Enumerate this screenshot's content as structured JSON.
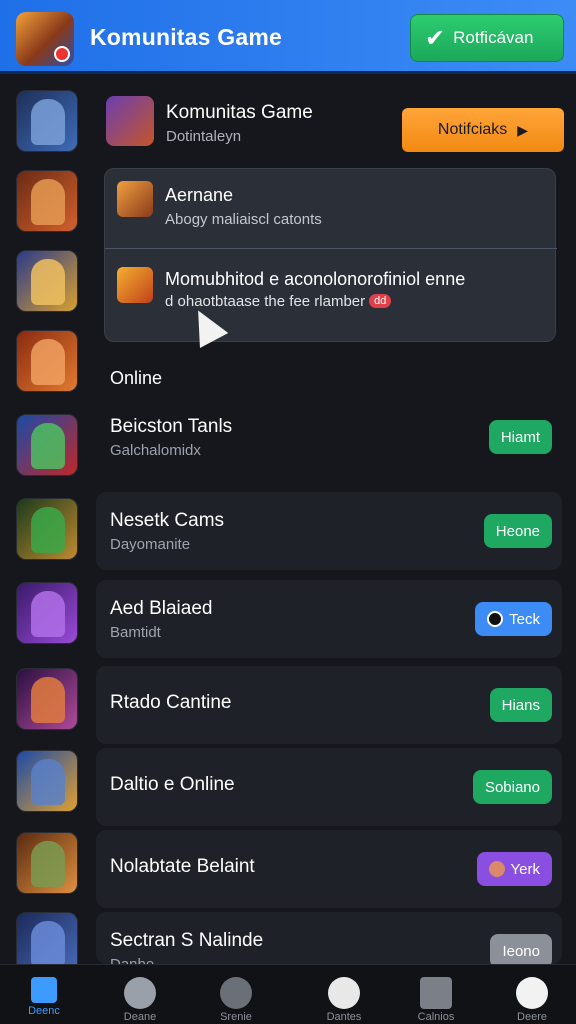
{
  "header": {
    "title": "Komunitas Game",
    "notif_button": "Rotficávan",
    "brand_color": "#2f7ff2"
  },
  "hero": {
    "title": "Komunitas Game",
    "subtitle": "Dotintaleyn",
    "button": "Notifciaks"
  },
  "dropdown": {
    "items": [
      {
        "title": "Aernane",
        "subtitle": "Abogy maliaiscl catonts"
      },
      {
        "title": "Momubhitod",
        "title_rest": " e aconolonorofiniol enne",
        "subtitle": "d ohaotbtaase the fee rlamber",
        "badge": "dd"
      }
    ]
  },
  "section": {
    "label": "Online"
  },
  "rows": [
    {
      "title": "Beicston Tanls",
      "subtitle": "Galchalomidx",
      "button": "Hiamt",
      "color": "#1ea862"
    },
    {
      "title": "Nesetk Cams",
      "subtitle": "Dayomanite",
      "button": "Heone",
      "color": "#1ea862"
    },
    {
      "title": "Aed Blaiaed",
      "subtitle": "Bamtidt",
      "button": "Teck",
      "color": "#3d8cf6"
    },
    {
      "title": "Rtado Cantine",
      "subtitle": "",
      "button": "Hians",
      "color": "#1ea862"
    },
    {
      "title": "Daltio e Online",
      "subtitle": "",
      "button": "Sobiano",
      "color": "#1ea862"
    },
    {
      "title": "Nolabtate Belaint",
      "subtitle": "",
      "button": "Yerk",
      "color": "#8a4fe0"
    },
    {
      "title": "Sectran S Nalinde",
      "subtitle": "Danbe",
      "button": "Ieono",
      "color": "#8c9099"
    }
  ],
  "sidebar_icons": [
    "knight-icon",
    "warrior-icon",
    "archer-icon",
    "gunner-icon",
    "hero-icon",
    "orc-icon",
    "wizard-icon",
    "rogue-icon",
    "ranger-icon",
    "dwarf-icon",
    "soldier-icon"
  ],
  "bottom_nav": [
    {
      "label": "Deenc",
      "icon": "home-icon"
    },
    {
      "label": "Deane",
      "icon": "avatar-icon"
    },
    {
      "label": "Srenie",
      "icon": "face-icon"
    },
    {
      "label": "Dantes",
      "icon": "ghost-icon"
    },
    {
      "label": "Calnios",
      "icon": "store-icon"
    },
    {
      "label": "Deere",
      "icon": "profile-icon"
    }
  ]
}
